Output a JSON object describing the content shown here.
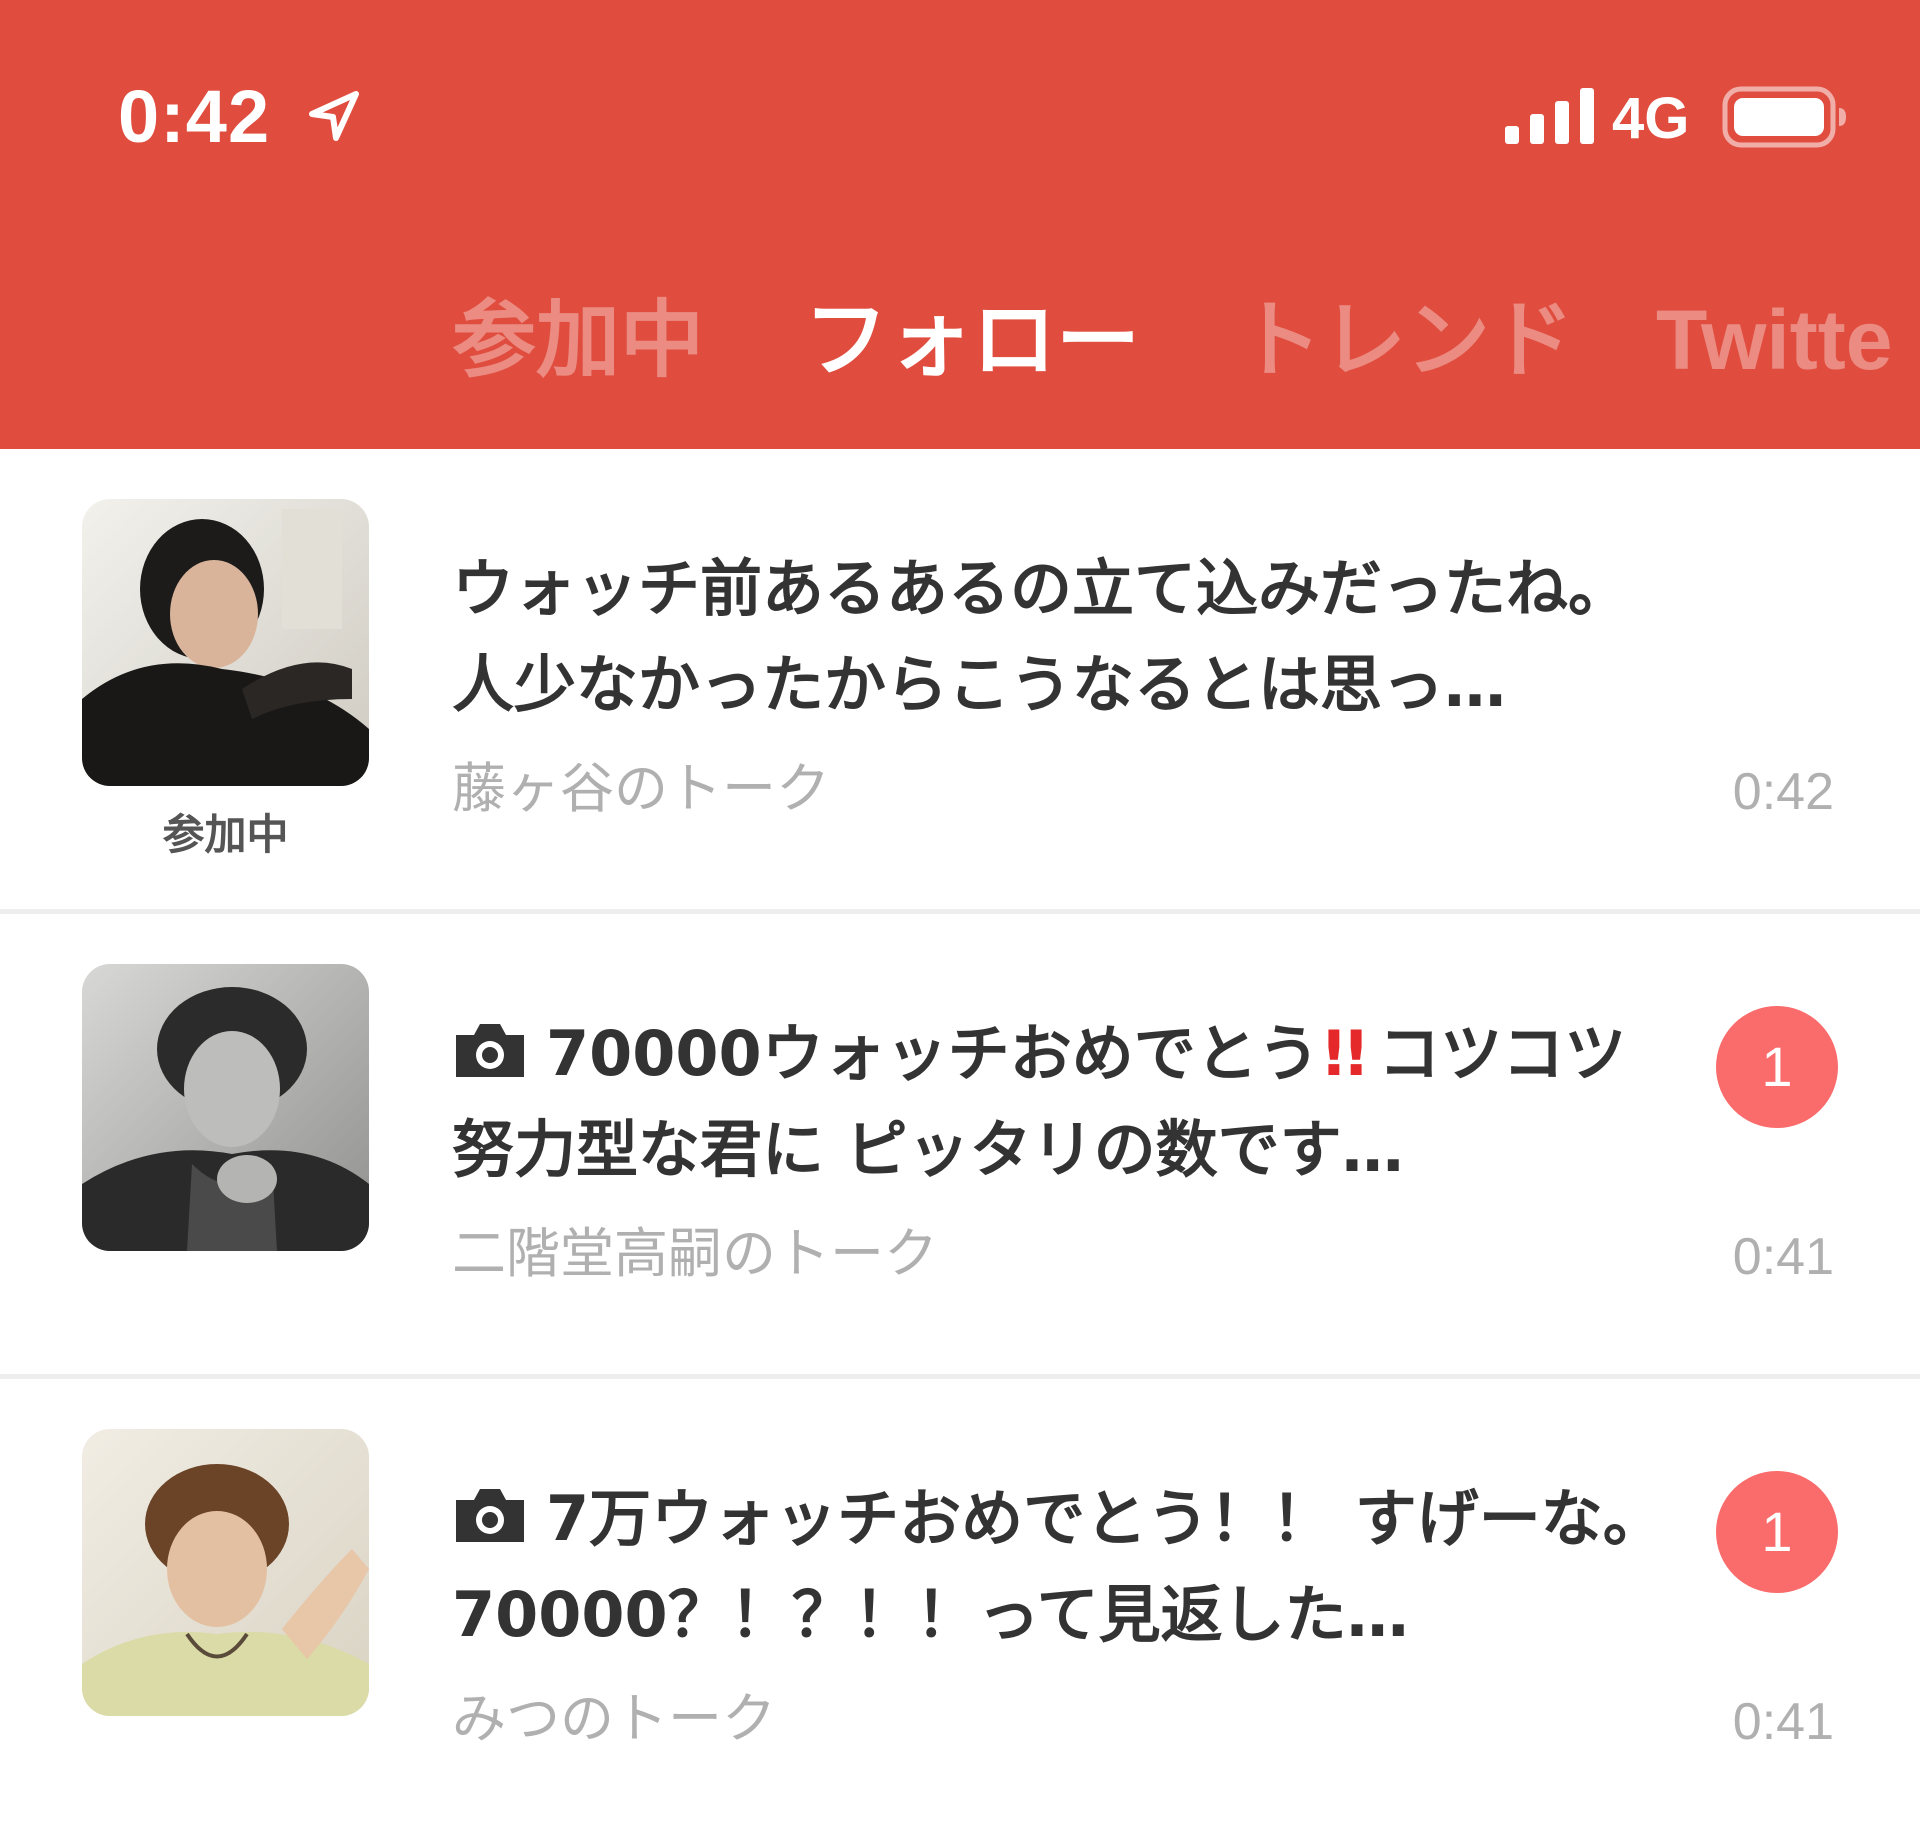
{
  "status_bar": {
    "time": "0:42",
    "network": "4G"
  },
  "tabs": [
    {
      "label": "参加中",
      "active": false
    },
    {
      "label": "フォロー",
      "active": true
    },
    {
      "label": "トレンド",
      "active": false
    },
    {
      "label": "Twitte",
      "active": false
    }
  ],
  "feed": [
    {
      "message": "ウォッチ前あるあるの立て込みだったね。人少なかったからこうなるとは思っ…",
      "talk_name": "藤ヶ谷のトーク",
      "time": "0:42",
      "joined_label": "参加中",
      "unread": null
    },
    {
      "message_prefix": "70000ウォッチおめでとう",
      "message_emoji": "!!",
      "message_suffix": "コツコツ努力型な君に ピッタリの数です…",
      "talk_name": "二階堂高嗣のトーク",
      "time": "0:41",
      "unread": "1"
    },
    {
      "message": "7万ウォッチおめでとう！！ すげーな。 70000？！？！！って見返した…",
      "talk_name": "みつのトーク",
      "time": "0:41",
      "unread": "1"
    }
  ],
  "colors": {
    "header_bg": "#e04d3f",
    "badge_bg": "#fa6b6b",
    "emoji_red": "#e5282a",
    "muted_text": "#b0b0b0",
    "body_text": "#333333"
  },
  "icons": {
    "location": "location-arrow-icon",
    "signal": "cellular-signal-icon",
    "battery": "battery-icon",
    "camera": "camera-icon"
  }
}
